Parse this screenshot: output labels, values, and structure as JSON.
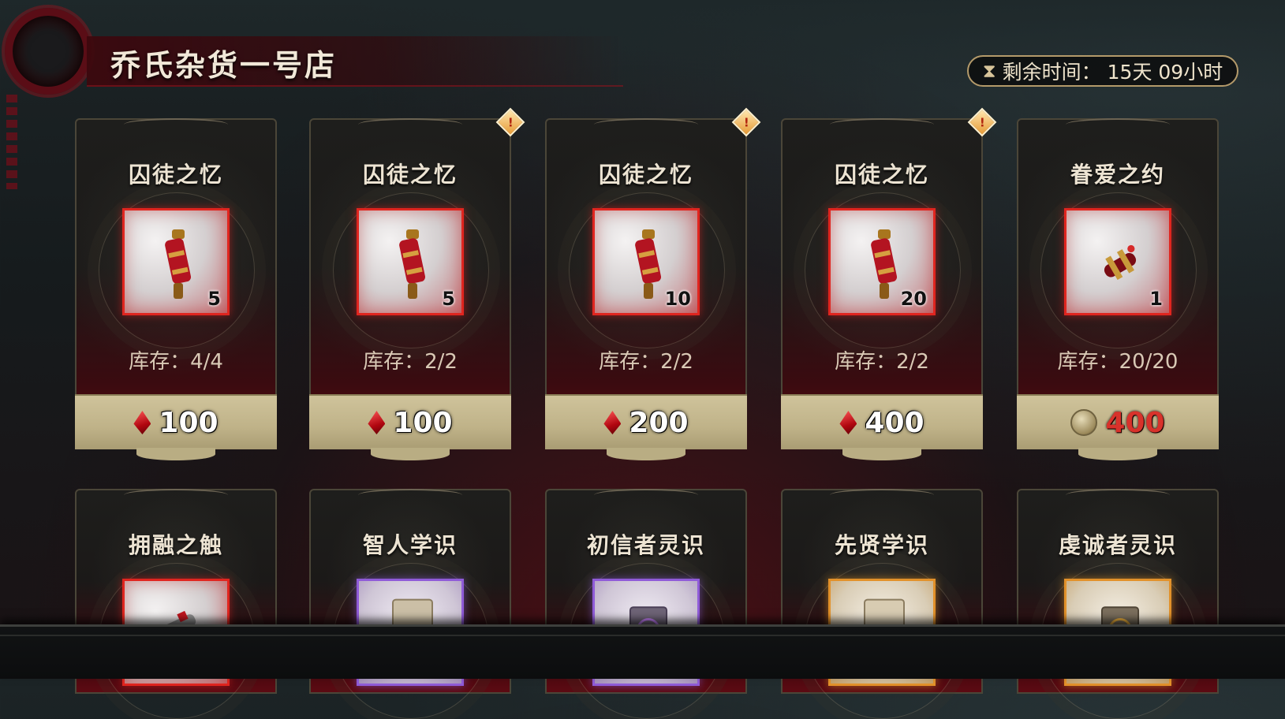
{
  "header": {
    "shop_title": "乔氏杂货一号店",
    "timer_icon": "hourglass-icon",
    "timer_label": "剩余时间：",
    "timer_value": "15天 09小时"
  },
  "colors": {
    "accent_red": "#d8322b",
    "frame_red": "#e0251f",
    "frame_purple": "#8f5bd8",
    "frame_gold": "#e2912a",
    "price_bar": "#c9bd94"
  },
  "row1": [
    {
      "name": "囚徒之忆",
      "qty": "5",
      "stock": "库存：4/4",
      "price": "100",
      "currency": "red-gem-icon",
      "badge": false
    },
    {
      "name": "囚徒之忆",
      "qty": "5",
      "stock": "库存：2/2",
      "price": "100",
      "currency": "red-gem-icon",
      "badge": true
    },
    {
      "name": "囚徒之忆",
      "qty": "10",
      "stock": "库存：2/2",
      "price": "200",
      "currency": "red-gem-icon",
      "badge": true
    },
    {
      "name": "囚徒之忆",
      "qty": "20",
      "stock": "库存：2/2",
      "price": "400",
      "currency": "red-gem-icon",
      "badge": true
    },
    {
      "name": "眷爱之约",
      "qty": "1",
      "stock": "库存：20/20",
      "price": "400",
      "currency": "coin-icon",
      "badge": false
    }
  ],
  "row2": [
    {
      "name": "拥融之触",
      "frame": "red",
      "icon": "scroll-case-icon"
    },
    {
      "name": "智人学识",
      "frame": "purple",
      "icon": "tome-icon"
    },
    {
      "name": "初信者灵识",
      "frame": "purple",
      "icon": "sigil-book-icon"
    },
    {
      "name": "先贤学识",
      "frame": "gold",
      "icon": "tome-icon"
    },
    {
      "name": "虔诚者灵识",
      "frame": "gold",
      "icon": "sigil-book-icon"
    }
  ]
}
